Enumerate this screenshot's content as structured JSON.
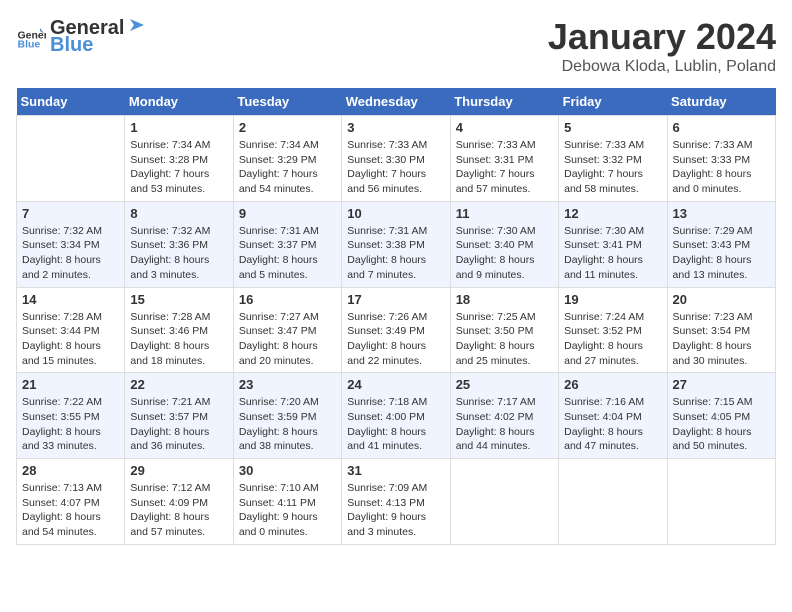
{
  "header": {
    "logo_general": "General",
    "logo_blue": "Blue",
    "month_year": "January 2024",
    "location": "Debowa Kloda, Lublin, Poland"
  },
  "days_of_week": [
    "Sunday",
    "Monday",
    "Tuesday",
    "Wednesday",
    "Thursday",
    "Friday",
    "Saturday"
  ],
  "weeks": [
    [
      {
        "day": "",
        "info": ""
      },
      {
        "day": "1",
        "info": "Sunrise: 7:34 AM\nSunset: 3:28 PM\nDaylight: 7 hours\nand 53 minutes."
      },
      {
        "day": "2",
        "info": "Sunrise: 7:34 AM\nSunset: 3:29 PM\nDaylight: 7 hours\nand 54 minutes."
      },
      {
        "day": "3",
        "info": "Sunrise: 7:33 AM\nSunset: 3:30 PM\nDaylight: 7 hours\nand 56 minutes."
      },
      {
        "day": "4",
        "info": "Sunrise: 7:33 AM\nSunset: 3:31 PM\nDaylight: 7 hours\nand 57 minutes."
      },
      {
        "day": "5",
        "info": "Sunrise: 7:33 AM\nSunset: 3:32 PM\nDaylight: 7 hours\nand 58 minutes."
      },
      {
        "day": "6",
        "info": "Sunrise: 7:33 AM\nSunset: 3:33 PM\nDaylight: 8 hours\nand 0 minutes."
      }
    ],
    [
      {
        "day": "7",
        "info": "Sunrise: 7:32 AM\nSunset: 3:34 PM\nDaylight: 8 hours\nand 2 minutes."
      },
      {
        "day": "8",
        "info": "Sunrise: 7:32 AM\nSunset: 3:36 PM\nDaylight: 8 hours\nand 3 minutes."
      },
      {
        "day": "9",
        "info": "Sunrise: 7:31 AM\nSunset: 3:37 PM\nDaylight: 8 hours\nand 5 minutes."
      },
      {
        "day": "10",
        "info": "Sunrise: 7:31 AM\nSunset: 3:38 PM\nDaylight: 8 hours\nand 7 minutes."
      },
      {
        "day": "11",
        "info": "Sunrise: 7:30 AM\nSunset: 3:40 PM\nDaylight: 8 hours\nand 9 minutes."
      },
      {
        "day": "12",
        "info": "Sunrise: 7:30 AM\nSunset: 3:41 PM\nDaylight: 8 hours\nand 11 minutes."
      },
      {
        "day": "13",
        "info": "Sunrise: 7:29 AM\nSunset: 3:43 PM\nDaylight: 8 hours\nand 13 minutes."
      }
    ],
    [
      {
        "day": "14",
        "info": "Sunrise: 7:28 AM\nSunset: 3:44 PM\nDaylight: 8 hours\nand 15 minutes."
      },
      {
        "day": "15",
        "info": "Sunrise: 7:28 AM\nSunset: 3:46 PM\nDaylight: 8 hours\nand 18 minutes."
      },
      {
        "day": "16",
        "info": "Sunrise: 7:27 AM\nSunset: 3:47 PM\nDaylight: 8 hours\nand 20 minutes."
      },
      {
        "day": "17",
        "info": "Sunrise: 7:26 AM\nSunset: 3:49 PM\nDaylight: 8 hours\nand 22 minutes."
      },
      {
        "day": "18",
        "info": "Sunrise: 7:25 AM\nSunset: 3:50 PM\nDaylight: 8 hours\nand 25 minutes."
      },
      {
        "day": "19",
        "info": "Sunrise: 7:24 AM\nSunset: 3:52 PM\nDaylight: 8 hours\nand 27 minutes."
      },
      {
        "day": "20",
        "info": "Sunrise: 7:23 AM\nSunset: 3:54 PM\nDaylight: 8 hours\nand 30 minutes."
      }
    ],
    [
      {
        "day": "21",
        "info": "Sunrise: 7:22 AM\nSunset: 3:55 PM\nDaylight: 8 hours\nand 33 minutes."
      },
      {
        "day": "22",
        "info": "Sunrise: 7:21 AM\nSunset: 3:57 PM\nDaylight: 8 hours\nand 36 minutes."
      },
      {
        "day": "23",
        "info": "Sunrise: 7:20 AM\nSunset: 3:59 PM\nDaylight: 8 hours\nand 38 minutes."
      },
      {
        "day": "24",
        "info": "Sunrise: 7:18 AM\nSunset: 4:00 PM\nDaylight: 8 hours\nand 41 minutes."
      },
      {
        "day": "25",
        "info": "Sunrise: 7:17 AM\nSunset: 4:02 PM\nDaylight: 8 hours\nand 44 minutes."
      },
      {
        "day": "26",
        "info": "Sunrise: 7:16 AM\nSunset: 4:04 PM\nDaylight: 8 hours\nand 47 minutes."
      },
      {
        "day": "27",
        "info": "Sunrise: 7:15 AM\nSunset: 4:05 PM\nDaylight: 8 hours\nand 50 minutes."
      }
    ],
    [
      {
        "day": "28",
        "info": "Sunrise: 7:13 AM\nSunset: 4:07 PM\nDaylight: 8 hours\nand 54 minutes."
      },
      {
        "day": "29",
        "info": "Sunrise: 7:12 AM\nSunset: 4:09 PM\nDaylight: 8 hours\nand 57 minutes."
      },
      {
        "day": "30",
        "info": "Sunrise: 7:10 AM\nSunset: 4:11 PM\nDaylight: 9 hours\nand 0 minutes."
      },
      {
        "day": "31",
        "info": "Sunrise: 7:09 AM\nSunset: 4:13 PM\nDaylight: 9 hours\nand 3 minutes."
      },
      {
        "day": "",
        "info": ""
      },
      {
        "day": "",
        "info": ""
      },
      {
        "day": "",
        "info": ""
      }
    ]
  ]
}
